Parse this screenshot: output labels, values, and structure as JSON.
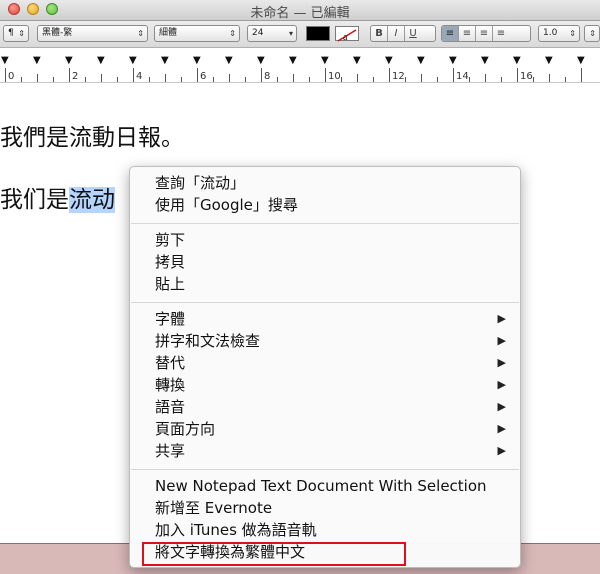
{
  "window": {
    "title": "未命名 — 已編輯"
  },
  "toolbar": {
    "paragraph_style": "¶",
    "font_family": "黑體-繁",
    "font_style": "細體",
    "font_size": "24",
    "bold": "B",
    "italic": "I",
    "underline": "U",
    "line_spacing": "1.0",
    "text_color": "#000000"
  },
  "ruler": {
    "labels": [
      "0",
      "2",
      "4",
      "6",
      "8",
      "10",
      "12",
      "14",
      "16"
    ]
  },
  "document": {
    "line1": "我們是流動日報。",
    "line2_before": "我们是",
    "line2_selected": "流动"
  },
  "context_menu": {
    "lookup": "查詢「流动」",
    "search_google": "使用「Google」搜尋",
    "cut": "剪下",
    "copy": "拷貝",
    "paste": "貼上",
    "font": "字體",
    "spelling": "拼字和文法檢查",
    "substitutions": "替代",
    "transformations": "轉換",
    "speech": "語音",
    "layout_orientation": "頁面方向",
    "share": "共享",
    "new_notepad": "New Notepad Text Document With Selection",
    "add_evernote": "新增至 Evernote",
    "add_itunes": "加入 iTunes 做為語音軌",
    "convert_traditional": "將文字轉換為繁體中文",
    "submenu_arrow": "▶"
  }
}
